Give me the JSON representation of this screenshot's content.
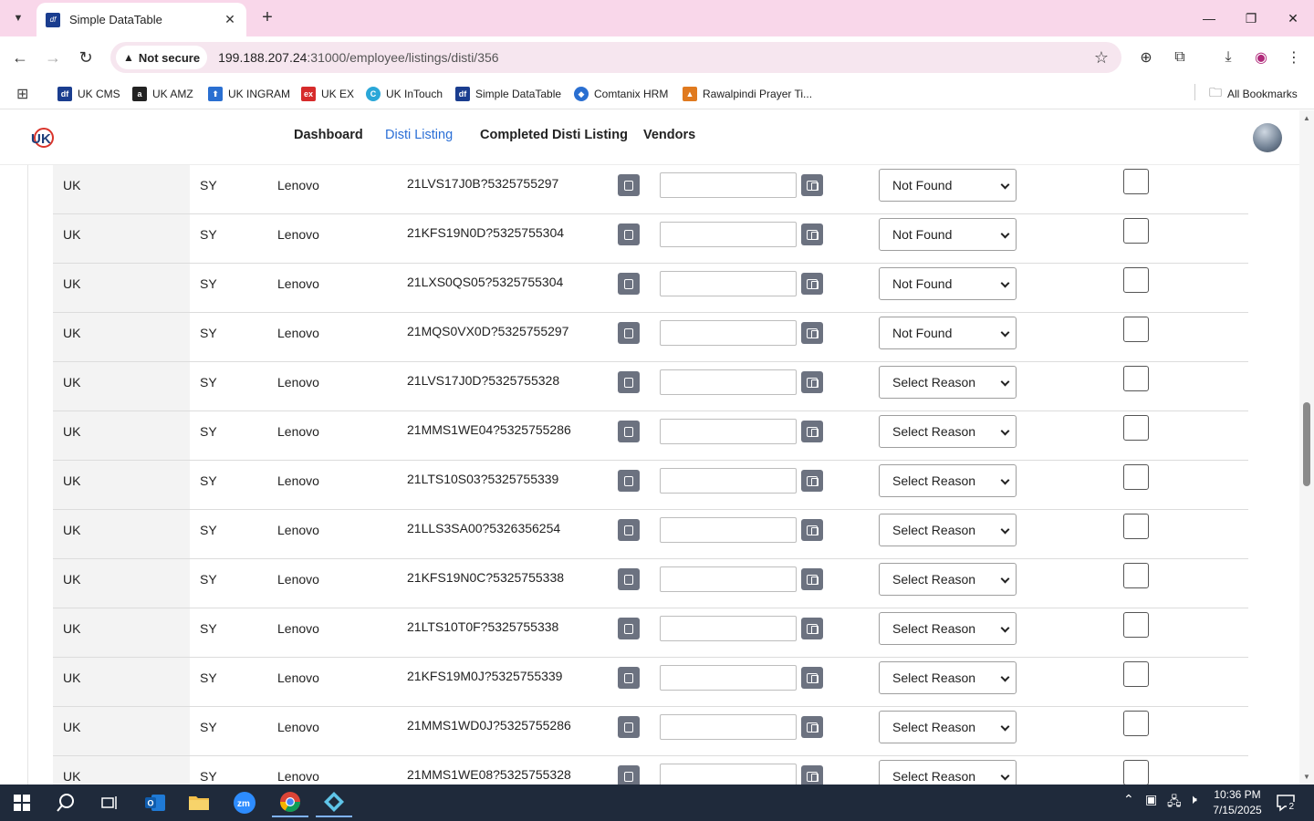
{
  "browser": {
    "tab_title": "Simple DataTable",
    "tab_favicon_text": "df",
    "security_label": "Not secure",
    "url_host": "199.188.207.24",
    "url_path": ":31000/employee/listings/disti/356"
  },
  "bookmarks": [
    {
      "label": "UK CMS",
      "color": "#1a3d8f",
      "glyph": "df"
    },
    {
      "label": "UK AMZ",
      "color": "#222222",
      "glyph": "a"
    },
    {
      "label": "UK INGRAM",
      "color": "#2a6fd1",
      "glyph": "⬆"
    },
    {
      "label": "UK EX",
      "color": "#d62b2b",
      "glyph": "ex"
    },
    {
      "label": "UK InTouch",
      "color": "#2aa7d8",
      "glyph": "C"
    },
    {
      "label": "Simple DataTable",
      "color": "#1a3d8f",
      "glyph": "df"
    },
    {
      "label": "Comtanix HRM",
      "color": "#2a6fd1",
      "glyph": "◆"
    },
    {
      "label": "Rawalpindi Prayer Ti...",
      "color": "#e07a1f",
      "glyph": "▲"
    }
  ],
  "all_bookmarks_label": "All Bookmarks",
  "nav": {
    "links": [
      {
        "label": "Dashboard",
        "active": false
      },
      {
        "label": "Disti Listing",
        "active": true
      },
      {
        "label": "Completed Disti Listing",
        "active": false
      },
      {
        "label": "Vendors",
        "active": false
      }
    ]
  },
  "rows": [
    {
      "country": "UK",
      "code": "SY",
      "brand": "Lenovo",
      "sku": "21LVS17J0B?5325755297",
      "input": "",
      "reason": "Not Found"
    },
    {
      "country": "UK",
      "code": "SY",
      "brand": "Lenovo",
      "sku": "21KFS19N0D?5325755304",
      "input": "",
      "reason": "Not Found"
    },
    {
      "country": "UK",
      "code": "SY",
      "brand": "Lenovo",
      "sku": "21LXS0QS05?5325755304",
      "input": "",
      "reason": "Not Found"
    },
    {
      "country": "UK",
      "code": "SY",
      "brand": "Lenovo",
      "sku": "21MQS0VX0D?5325755297",
      "input": "",
      "reason": "Not Found"
    },
    {
      "country": "UK",
      "code": "SY",
      "brand": "Lenovo",
      "sku": "21LVS17J0D?5325755328",
      "input": "",
      "reason": "Select Reason"
    },
    {
      "country": "UK",
      "code": "SY",
      "brand": "Lenovo",
      "sku": "21MMS1WE04?5325755286",
      "input": "",
      "reason": "Select Reason"
    },
    {
      "country": "UK",
      "code": "SY",
      "brand": "Lenovo",
      "sku": "21LTS10S03?5325755339",
      "input": "",
      "reason": "Select Reason"
    },
    {
      "country": "UK",
      "code": "SY",
      "brand": "Lenovo",
      "sku": "21LLS3SA00?5326356254",
      "input": "",
      "reason": "Select Reason"
    },
    {
      "country": "UK",
      "code": "SY",
      "brand": "Lenovo",
      "sku": "21KFS19N0C?5325755338",
      "input": "",
      "reason": "Select Reason"
    },
    {
      "country": "UK",
      "code": "SY",
      "brand": "Lenovo",
      "sku": "21LTS10T0F?5325755338",
      "input": "",
      "reason": "Select Reason"
    },
    {
      "country": "UK",
      "code": "SY",
      "brand": "Lenovo",
      "sku": "21KFS19M0J?5325755339",
      "input": "",
      "reason": "Select Reason"
    },
    {
      "country": "UK",
      "code": "SY",
      "brand": "Lenovo",
      "sku": "21MMS1WD0J?5325755286",
      "input": "",
      "reason": "Select Reason"
    },
    {
      "country": "UK",
      "code": "SY",
      "brand": "Lenovo",
      "sku": "21MMS1WE08?5325755328",
      "input": "",
      "reason": "Select Reason"
    }
  ],
  "taskbar": {
    "time": "10:36 PM",
    "date": "7/15/2025",
    "notification_count": "2"
  }
}
